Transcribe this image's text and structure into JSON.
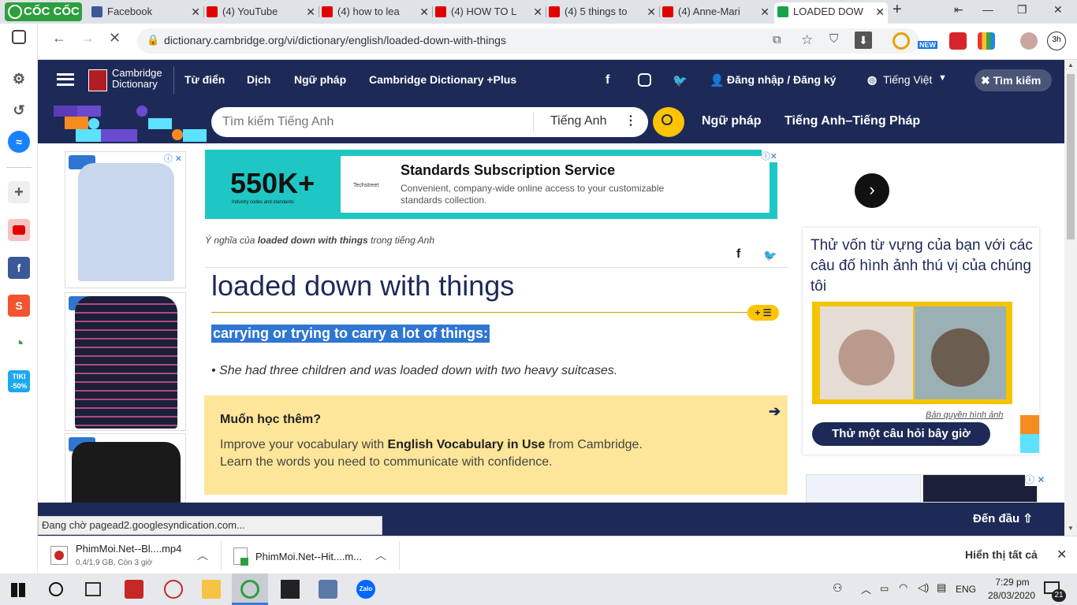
{
  "browser": {
    "brand": "CỐC CỐC",
    "tabs": [
      {
        "title": "Facebook",
        "color": "#3b5998"
      },
      {
        "title": "(4) YouTube",
        "color": "#e00000"
      },
      {
        "title": "(4) how to lea",
        "color": "#e00000"
      },
      {
        "title": "(4) HOW TO L",
        "color": "#e00000"
      },
      {
        "title": "(4) 5 things to",
        "color": "#e00000"
      },
      {
        "title": "(4) Anne-Mari",
        "color": "#e00000"
      },
      {
        "title": "LOADED DOW",
        "color": "#1aa34a"
      }
    ],
    "url": "dictionary.cambridge.org/vi/dictionary/english/loaded-down-with-things",
    "ext_badge": "NEW",
    "profile_time": "3h"
  },
  "sidebar": {
    "shopee": "S",
    "tiki": "TIKI\n-50%"
  },
  "site": {
    "logo_line1": "Cambridge",
    "logo_line2": "Dictionary",
    "nav": [
      "Từ điển",
      "Dịch",
      "Ngữ pháp",
      "Cambridge Dictionary +Plus"
    ],
    "login": "Đăng nhập / Đăng ký",
    "language": "Tiếng Việt",
    "search_btn": "Tìm kiếm",
    "search_placeholder": "Tìm kiếm Tiếng Anh",
    "search_lang": "Tiếng Anh",
    "sub_links": [
      "Ngữ pháp",
      "Tiếng Anh–Tiếng Pháp"
    ]
  },
  "ad": {
    "big_number": "550K+",
    "big_caption": "Industry codes and standards",
    "brand": "Techstreet",
    "title": "Standards Subscription Service",
    "text": "Convenient, company-wide online access to your customizable standards collection."
  },
  "entry": {
    "crumb_prefix": "Ý nghĩa của ",
    "crumb_word": "loaded down with things",
    "crumb_suffix": " trong tiếng Anh",
    "headword": "loaded down with things",
    "definition": "carrying or trying to carry a lot of things:",
    "example": "She had three children and was loaded down with two heavy suitcases."
  },
  "learn": {
    "title": "Muốn học thêm?",
    "line1_a": "Improve your vocabulary with ",
    "line1_b": "English Vocabulary in Use",
    "line1_c": " from Cambridge.",
    "line2": "Learn the words you need to communicate with confidence."
  },
  "quiz": {
    "text": "Thử vốn từ vựng của bạn với các câu đố hình ảnh thú vị của chúng tôi",
    "credit": "Bản quyền hình ảnh",
    "button": "Thử một câu hỏi bây giờ"
  },
  "pagebar": {
    "back_to_top": "Đến đầu"
  },
  "status": "Đang chờ pagead2.googlesyndication.com...",
  "downloads": [
    {
      "name": "PhimMoi.Net--Bl....mp4",
      "info": "0,4/1,9 GB, Còn 3 giờ"
    },
    {
      "name": "PhimMoi.Net--Hit....m...",
      "info": ""
    }
  ],
  "show_all": "Hiển thị tất cả",
  "taskbar": {
    "lang": "ENG",
    "time": "7:29 pm",
    "date": "28/03/2020",
    "notif": "21"
  }
}
